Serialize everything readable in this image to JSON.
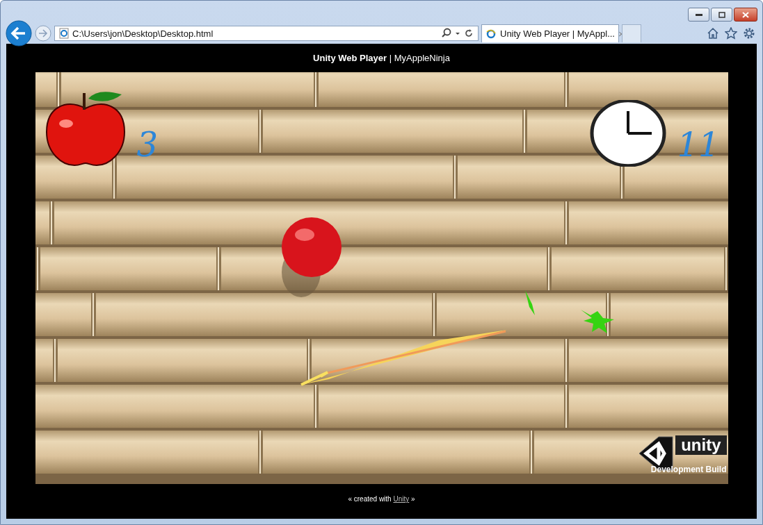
{
  "browser": {
    "address": "C:\\Users\\jon\\Desktop\\Desktop.html",
    "tab": {
      "title": "Unity Web Player | MyAppl...",
      "close": "×",
      "selected": true
    }
  },
  "page": {
    "title": "**Unity Web Player** | MyAppleNinja",
    "game": {
      "apples_score": "3",
      "time_left": "11",
      "logo_text": "unity",
      "build_label": "Development Build"
    },
    "footer": {
      "before": "« created with ",
      "link": "Unity",
      "after": " »"
    }
  }
}
